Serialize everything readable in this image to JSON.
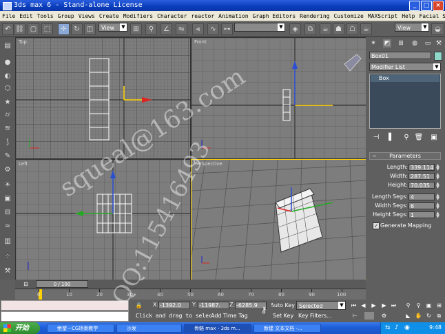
{
  "window": {
    "title": "3ds max 6 - Stand-alone License"
  },
  "menu": [
    "File",
    "Edit",
    "Tools",
    "Group",
    "Views",
    "Create",
    "Modifiers",
    "Character",
    "reactor",
    "Animation",
    "Graph Editors",
    "Rendering",
    "Customize",
    "MAXScript",
    "Help",
    "Facial Studio"
  ],
  "toolbar": {
    "refcoord": "View",
    "selset": "",
    "view2": "View"
  },
  "viewports": {
    "top": "Top",
    "front": "Front",
    "left": "Left",
    "persp": "Perspective"
  },
  "panel": {
    "object_name": "Box01",
    "modifier_list": "Modifier List",
    "stack_item": "Box",
    "params_title": "Parameters",
    "params": [
      {
        "label": "Length:",
        "value": "339.114"
      },
      {
        "label": "Width:",
        "value": "287.51"
      },
      {
        "label": "Height:",
        "value": "70.035"
      },
      {
        "label": "Length Segs:",
        "value": "4"
      },
      {
        "label": "Width Segs:",
        "value": "6"
      },
      {
        "label": "Height Segs:",
        "value": "1"
      }
    ],
    "generate_mapping": "Generate Mapping"
  },
  "time": {
    "slider": "0 / 100",
    "ticks": [
      "0",
      "10",
      "20",
      "30",
      "40",
      "50",
      "60",
      "70",
      "80",
      "90",
      "100"
    ]
  },
  "status": {
    "x": "-1392.0",
    "y": "-11987.",
    "z": "-6285.9",
    "autokey": "Auto Key",
    "selected": "Selected",
    "setkey": "Set Key",
    "keyfilters": "Key Filters...",
    "addtimetag": "Add Time Tag",
    "prompt": "Click and drag to select"
  },
  "taskbar": {
    "start": "开始",
    "tasks": [
      "绝望－CG场景教学",
      "沙发",
      "骨骼 max - 3ds m...",
      "新建 文本文档 -..."
    ],
    "clock": "9:48"
  },
  "watermark": {
    "line1": "squeal@163.com",
    "line2": "QQ:115416493"
  }
}
